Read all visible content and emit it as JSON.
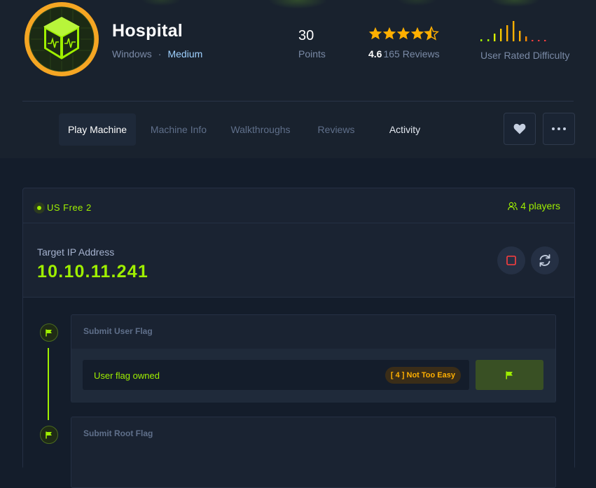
{
  "machine": {
    "name": "Hospital",
    "os": "Windows",
    "separator": "·",
    "difficulty": "Medium",
    "points_value": "30",
    "points_label": "Points",
    "rating": "4.6",
    "stars_filled": 4.5,
    "reviews_label": "165 Reviews",
    "user_rated_difficulty_label": "User Rated Difficulty"
  },
  "tabs": [
    {
      "label": "Play Machine",
      "active": true
    },
    {
      "label": "Machine Info"
    },
    {
      "label": "Walkthroughs"
    },
    {
      "label": "Reviews"
    },
    {
      "label": "Activity"
    }
  ],
  "panel": {
    "server_name": "US Free 2",
    "players": "4 players",
    "target_ip_label": "Target IP Address",
    "target_ip": "10.10.11.241",
    "user_flag": {
      "title": "Submit User Flag",
      "status": "User flag owned",
      "rating_badge": "[ 4 ] Not Too Easy"
    },
    "root_flag": {
      "title": "Submit Root Flag"
    }
  },
  "colors": {
    "accent_green": "#9fef00",
    "star_orange": "#ffaf00",
    "stop_red": "#ff3e3e",
    "background": "#141d2b"
  },
  "icons": [
    "machine-logo-icon",
    "star-icon",
    "heart-icon",
    "more-icon",
    "server-status-icon",
    "users-icon",
    "stop-icon",
    "refresh-icon",
    "flag-icon"
  ]
}
